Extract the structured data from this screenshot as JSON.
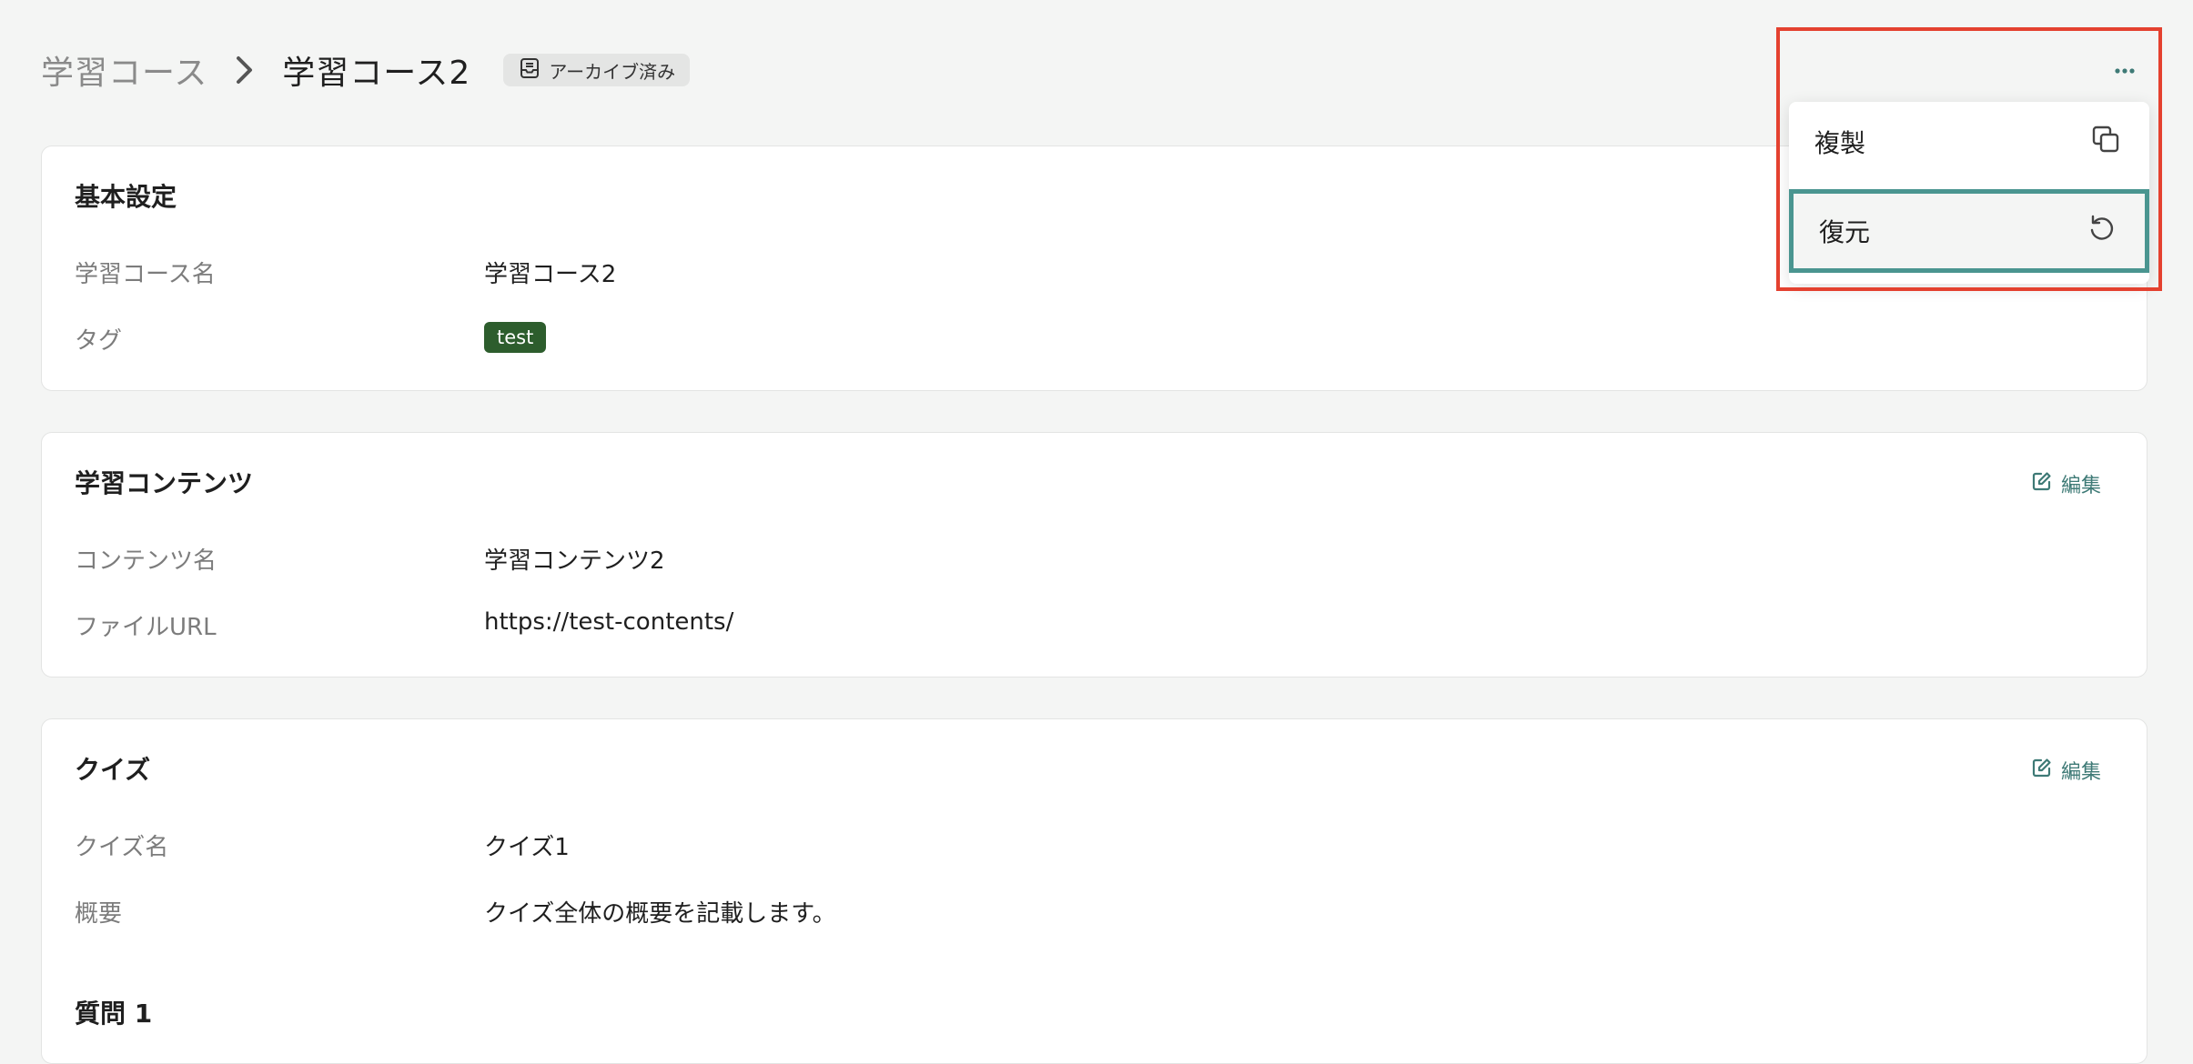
{
  "breadcrumb": {
    "parent": "学習コース",
    "current": "学習コース2"
  },
  "status_badge": {
    "label": "アーカイブ済み",
    "icon": "archive-icon"
  },
  "more_menu": {
    "icon": "more-horizontal-icon",
    "items": [
      {
        "label": "複製",
        "icon": "duplicate-icon"
      },
      {
        "label": "復元",
        "icon": "restore-icon"
      }
    ]
  },
  "sections": {
    "basic": {
      "title": "基本設定",
      "course_name_label": "学習コース名",
      "course_name_value": "学習コース2",
      "tag_label": "タグ",
      "tag_value": "test"
    },
    "content": {
      "title": "学習コンテンツ",
      "edit_label": "編集",
      "content_name_label": "コンテンツ名",
      "content_name_value": "学習コンテンツ2",
      "file_url_label": "ファイルURL",
      "file_url_value": "https://test-contents/"
    },
    "quiz": {
      "title": "クイズ",
      "edit_label": "編集",
      "quiz_name_label": "クイズ名",
      "quiz_name_value": "クイズ1",
      "summary_label": "概要",
      "summary_value": "クイズ全体の概要を記載します。",
      "question_heading": "質問 1"
    }
  },
  "colors": {
    "accent": "#3e7a76",
    "tag": "#2d5d2d",
    "highlight": "#e4412f",
    "focus": "#4a9590"
  }
}
